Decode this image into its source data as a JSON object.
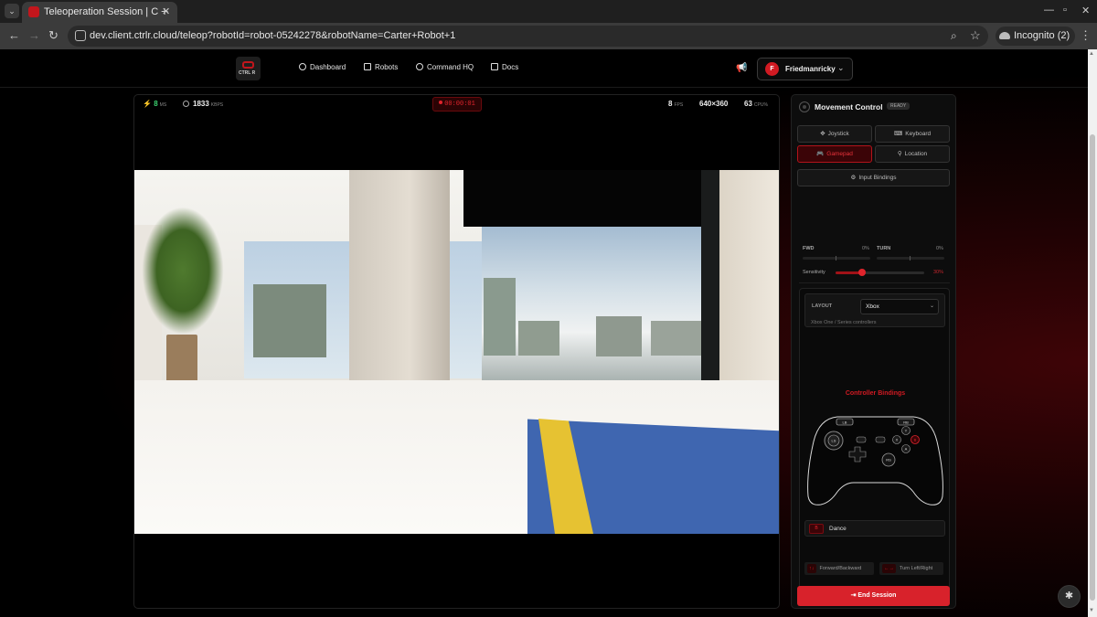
{
  "browser": {
    "tab_title": "Teleoperation Session | C",
    "url": "dev.client.ctrlr.cloud/teleop?robotId=robot-05242278&robotName=Carter+Robot+1",
    "incognito_label": "Incognito (2)"
  },
  "navbar": {
    "logo_text": "CTRL R",
    "links": [
      "Dashboard",
      "Robots",
      "Command HQ",
      "Docs"
    ],
    "user_initial": "F",
    "username": "Friedmanricky"
  },
  "video": {
    "stats": {
      "latency_value": "8",
      "latency_unit": "MS",
      "bitrate_value": "1833",
      "bitrate_unit": "KBPS",
      "fps_value": "8",
      "fps_unit": "FPS",
      "resolution": "640×360",
      "cpu_value": "63",
      "cpu_unit": "CPU%"
    },
    "timer": "00:00:01"
  },
  "control": {
    "title": "Movement Control",
    "status": "READY",
    "modes": [
      "Joystick",
      "Keyboard",
      "Gamepad",
      "Location"
    ],
    "active_mode": "Gamepad",
    "input_bindings": "Input Bindings",
    "axes": {
      "fwd_label": "FWD",
      "fwd_value": "0%",
      "turn_label": "TURN",
      "turn_value": "0%"
    },
    "sensitivity": {
      "label": "Sensitivity",
      "value": "30%",
      "level": 0.3
    },
    "layout": {
      "label": "LAYOUT",
      "selected": "Xbox",
      "description": "Xbox One / Series controllers"
    },
    "bindings_title": "Controller Bindings",
    "controller_buttons": {
      "lb": "LB",
      "rb": "RB",
      "y": "Y",
      "x": "X",
      "a": "A",
      "b": "B",
      "ls": "LS",
      "rs": "RS"
    },
    "binding": {
      "key": "B",
      "action": "Dance"
    },
    "hints": [
      {
        "key": "↑↓",
        "label": "Forward/Backward"
      },
      {
        "key": "←→",
        "label": "Turn Left/Right"
      }
    ],
    "end_session": "End Session"
  },
  "colors": {
    "accent": "#d8222b",
    "live_green": "#3bd16f",
    "background": "#000000"
  }
}
